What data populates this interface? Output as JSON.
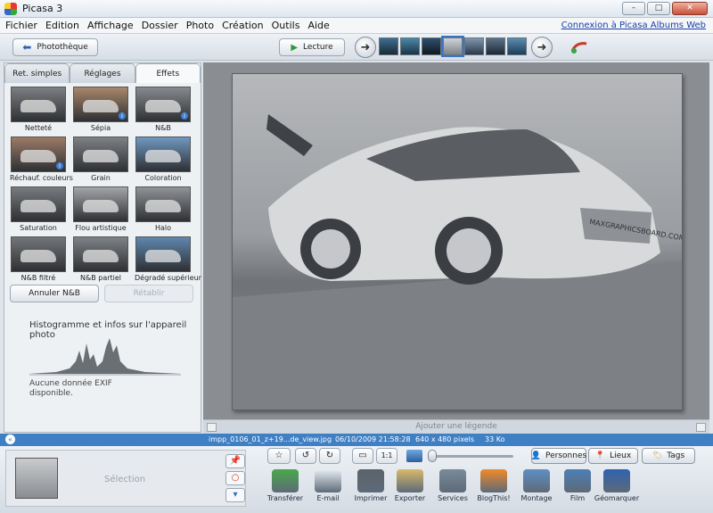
{
  "window": {
    "title": "Picasa 3",
    "controls": {
      "minimize": "–",
      "maximize": "□",
      "close": "✕"
    }
  },
  "menu": {
    "items": [
      "Fichier",
      "Edition",
      "Affichage",
      "Dossier",
      "Photo",
      "Création",
      "Outils",
      "Aide"
    ],
    "link": "Connexion à Picasa Albums Web"
  },
  "toolbar": {
    "library_button": "Photothèque",
    "play_button": "Lecture"
  },
  "left_panel": {
    "tabs": [
      "Ret. simples",
      "Réglages",
      "Effets"
    ],
    "active_tab": "Effets",
    "effects": [
      {
        "label": "Netteté",
        "tone": "#7b7e82",
        "info": false
      },
      {
        "label": "Sépia",
        "tone": "#a8876a",
        "info": true
      },
      {
        "label": "N&B",
        "tone": "#86898d",
        "info": true
      },
      {
        "label": "Réchauf. couleurs",
        "tone": "#9c7b67",
        "info": true
      },
      {
        "label": "Grain",
        "tone": "#7d8084",
        "info": false
      },
      {
        "label": "Coloration",
        "tone": "#6f98c0",
        "info": false
      },
      {
        "label": "Saturation",
        "tone": "#777a7e",
        "info": false
      },
      {
        "label": "Flou artistique",
        "tone": "#a3a5a8",
        "info": false
      },
      {
        "label": "Halo",
        "tone": "#8f9296",
        "info": false
      },
      {
        "label": "N&B filtré",
        "tone": "#727579",
        "info": false
      },
      {
        "label": "N&B partiel",
        "tone": "#7e8185",
        "info": false
      },
      {
        "label": "Dégradé supérieur",
        "tone": "#5f87ad",
        "info": false
      }
    ],
    "undo_button": "Annuler N&B",
    "redo_button": "Rétablir",
    "histogram_title": "Histogramme et infos sur l'appareil photo",
    "exif_text": "Aucune donnée EXIF disponible."
  },
  "photo": {
    "watermark": "MAXGRAPHICSBOARD.COM"
  },
  "caption": {
    "placeholder": "Ajouter une légende"
  },
  "status": {
    "filename": "impp_0106_01_z+19...de_view.jpg",
    "datetime": "06/10/2009 21:58:28",
    "dimensions": "640 x 480 pixels",
    "filesize": "33 Ko"
  },
  "tray": {
    "selection_label": "Sélection"
  },
  "tags": {
    "people": "Personnes",
    "places": "Lieux",
    "tags": "Tags"
  },
  "actions": [
    {
      "label": "Transférer",
      "icon": "upload-arrow-icon",
      "color": "#4aa84a"
    },
    {
      "label": "E-mail",
      "icon": "envelope-icon",
      "color": "#e8eef4"
    },
    {
      "label": "Imprimer",
      "icon": "printer-icon",
      "color": "#5b636b"
    },
    {
      "label": "Exporter",
      "icon": "folder-icon",
      "color": "#d9b86a"
    },
    {
      "label": "Services",
      "icon": "book-icon",
      "color": "#7a8a99"
    },
    {
      "label": "BlogThis!",
      "icon": "blogger-icon",
      "color": "#f18a2a"
    },
    {
      "label": "Montage",
      "icon": "montage-icon",
      "color": "#5f8fc3"
    },
    {
      "label": "Film",
      "icon": "film-icon",
      "color": "#4d7fb5"
    },
    {
      "label": "Géomarquer",
      "icon": "globe-icon",
      "color": "#2f62b0"
    }
  ]
}
